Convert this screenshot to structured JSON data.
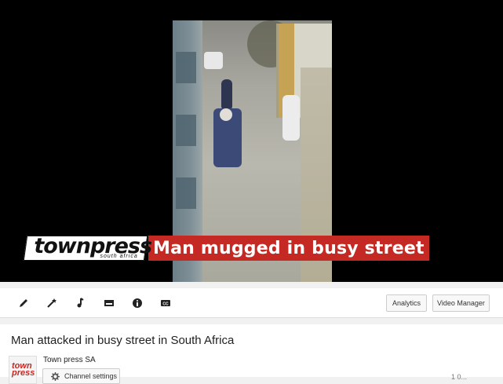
{
  "video": {
    "overlay_brand": "townpress",
    "overlay_brand_sub": "south africa",
    "overlay_headline": "Man mugged in busy street"
  },
  "toolbar": {
    "tools": [
      "pencil-icon",
      "magic-wand-icon",
      "music-note-icon",
      "card-icon",
      "info-icon",
      "closed-captions-icon"
    ],
    "analytics_label": "Analytics",
    "video_manager_label": "Video Manager"
  },
  "info": {
    "title": "Man attacked in busy street in South Africa",
    "channel_name": "Town press SA",
    "avatar_text": "town\npress",
    "channel_settings_label": "Channel settings",
    "views_partial": "1 0..."
  },
  "colors": {
    "brand_red": "#c42a23",
    "player_bg": "#000000",
    "page_bg": "#f1f1f1"
  }
}
